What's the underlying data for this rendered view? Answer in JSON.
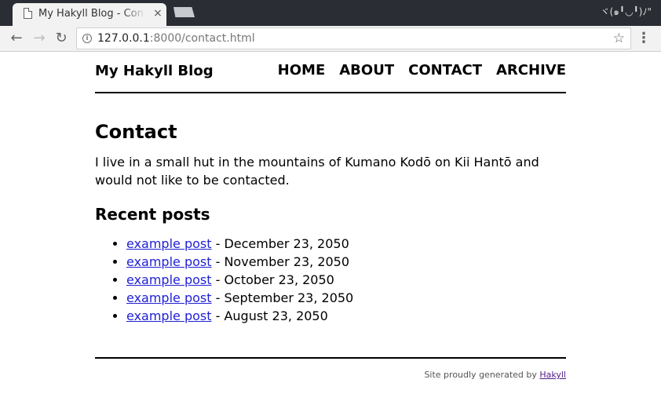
{
  "browser": {
    "tab_title": "My Hakyll Blog - Contact",
    "tab_close": "×",
    "kaomoji": "ヾ(๑╹◡╹)ﾉ\"",
    "url_host": "127.0.0.1",
    "url_rest": ":8000/contact.html",
    "back": "←",
    "forward": "→",
    "reload": "↻",
    "star": "☆",
    "menu": "⋮",
    "info": "i"
  },
  "site": {
    "logo": "My Hakyll Blog",
    "nav": [
      "HOME",
      "ABOUT",
      "CONTACT",
      "ARCHIVE"
    ]
  },
  "content": {
    "title": "Contact",
    "body": "I live in a small hut in the mountains of Kumano Kodō on Kii Hantō and would not like to be contacted.",
    "recent_heading": "Recent posts",
    "posts": [
      {
        "title": "example post",
        "date": " - December 23, 2050"
      },
      {
        "title": "example post",
        "date": " - November 23, 2050"
      },
      {
        "title": "example post",
        "date": " - October 23, 2050"
      },
      {
        "title": "example post",
        "date": " - September 23, 2050"
      },
      {
        "title": "example post",
        "date": " - August 23, 2050"
      }
    ]
  },
  "footer": {
    "prefix": "Site proudly generated by ",
    "link": "Hakyll"
  }
}
